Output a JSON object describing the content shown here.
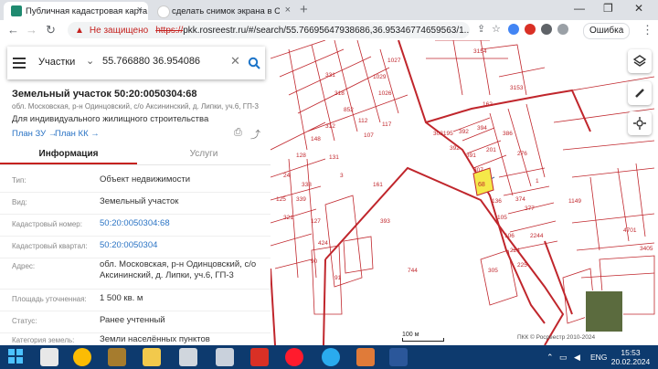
{
  "browser": {
    "tabs": [
      {
        "title": "Публичная кадастровая карта",
        "active": true
      },
      {
        "title": "сделать снимок экрана в Chrom",
        "active": false
      }
    ],
    "not_secure_label": "Не защищено",
    "url_prefix": "https://",
    "url_rest": "pkk.rosreestr.ru/#/search/55.76695647938686,36.95346774659563/1...",
    "error_label": "Ошибка"
  },
  "search": {
    "layer_select": "Участки",
    "query": "55.766880 36.954086"
  },
  "parcel": {
    "title": "Земельный участок 50:20:0050304:68",
    "address_short": "обл. Московская, р-н Одинцовский, с/о Аксининский, д. Липки, уч.6, ГП-3",
    "purpose": "Для индивидуального жилищного строительства",
    "plan_zu": "План ЗУ",
    "plan_kk": "План КК",
    "tabs": {
      "info": "Информация",
      "services": "Услуги"
    },
    "rows": [
      {
        "key": "Тип:",
        "value": "Объект недвижимости",
        "link": false
      },
      {
        "key": "Вид:",
        "value": "Земельный участок",
        "link": false
      },
      {
        "key": "Кадастровый номер:",
        "value": "50:20:0050304:68",
        "link": true
      },
      {
        "key": "Кадастровый квартал:",
        "value": "50:20:0050304",
        "link": true
      },
      {
        "key": "Адрес:",
        "value": "обл. Московская, р-н Одинцовский, с/о Аксининский, д. Липки, уч.6, ГП-3",
        "link": false
      },
      {
        "key": "Площадь уточненная:",
        "value": "1 500 кв. м",
        "link": false
      },
      {
        "key": "Статус:",
        "value": "Ранее учтенный",
        "link": false
      },
      {
        "key": "Категория земель:",
        "value": "Земли населённых пунктов",
        "link": false
      }
    ]
  },
  "map": {
    "scale_label": "100 м",
    "copyright": "ПКК © Росреестр 2010-2024",
    "selected_parcel_label": "68",
    "parcel_numbers": [
      "3154",
      "3153",
      "162",
      "1027",
      "1029",
      "1026",
      "331",
      "318",
      "852",
      "312",
      "112",
      "107",
      "117",
      "148",
      "128",
      "131",
      "3",
      "161",
      "24",
      "338",
      "339",
      "125",
      "321",
      "127",
      "393",
      "424",
      "90",
      "91",
      "744",
      "303195",
      "392",
      "394",
      "392",
      "391",
      "386",
      "276",
      "201",
      "307",
      "374",
      "136",
      "105",
      "106",
      "224",
      "225",
      "2244",
      "4701",
      "3405",
      "305",
      "1149",
      "377",
      "1"
    ],
    "colors": {
      "boundary": "#c0262c",
      "selected": "#f5e94a"
    }
  },
  "taskbar": {
    "lang": "ENG",
    "time": "15:53",
    "date": "20.02.2024"
  }
}
